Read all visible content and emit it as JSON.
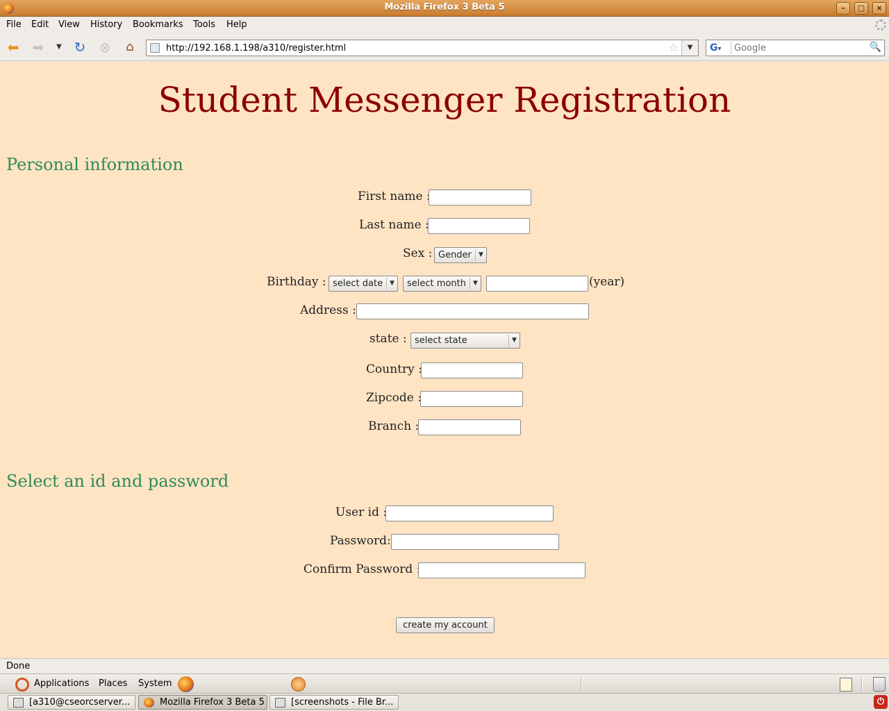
{
  "window": {
    "title": "Mozilla Firefox 3 Beta 5"
  },
  "menu": {
    "file": "File",
    "edit": "Edit",
    "view": "View",
    "history": "History",
    "bookmarks": "Bookmarks",
    "tools": "Tools",
    "help": "Help"
  },
  "nav": {
    "url": "http://192.168.1.198/a310/register.html",
    "search_placeholder": "Google"
  },
  "page": {
    "title": "Student Messenger Registration",
    "section_personal": "Personal information",
    "section_account": "Select an id and password",
    "first_name_label": "First name :",
    "last_name_label": "Last name :",
    "sex_label": "Sex :",
    "sex_value": "Gender",
    "birthday_label": "Birthday :",
    "date_value": "select date",
    "month_value": "select month",
    "year_suffix": "(year)",
    "address_label": "Address :",
    "state_label": "state :",
    "state_value": "select state",
    "country_label": "Country :",
    "zipcode_label": "Zipcode :",
    "branch_label": "Branch :",
    "userid_label": "User id :",
    "password_label": "Password:",
    "confirm_label": "Confirm Password :",
    "submit_label": "create my account"
  },
  "status": {
    "text": "Done"
  },
  "panel": {
    "applications": "Applications",
    "places": "Places",
    "system": "System"
  },
  "taskbar": {
    "tasks": [
      {
        "label": "[a310@cseorcserver..."
      },
      {
        "label": "Mozilla Firefox 3 Beta 5"
      },
      {
        "label": "[screenshots - File Br..."
      }
    ]
  }
}
